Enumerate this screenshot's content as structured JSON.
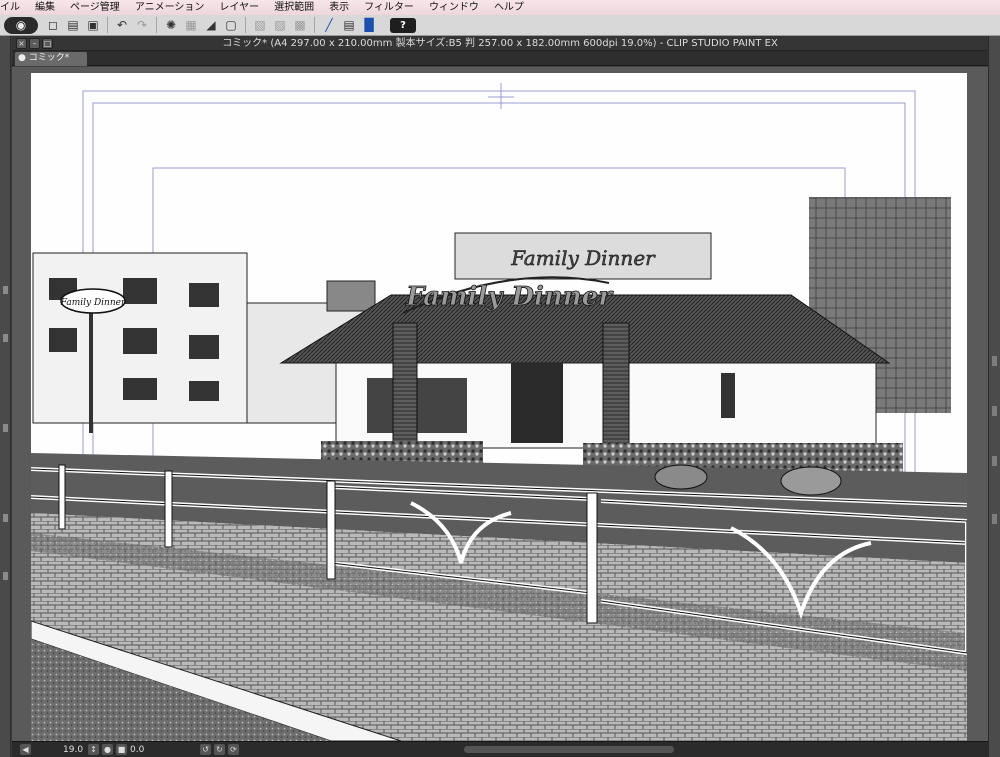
{
  "menubar": {
    "items": [
      "イル",
      "編集",
      "ページ管理",
      "アニメーション",
      "レイヤー",
      "選択範囲",
      "表示",
      "フィルター",
      "ウィンドウ",
      "ヘルプ"
    ]
  },
  "toolbar": {
    "icons": [
      "app-logo-icon",
      "new-file-icon",
      "open-file-icon",
      "save-icon",
      "undo-icon",
      "redo-icon",
      "transform-icon",
      "fill-icon",
      "ruler-icon",
      "help-icon"
    ],
    "help_label": "?"
  },
  "window": {
    "title": "コミック* (A4 297.00 x 210.00mm 製本サイズ:B5 判 257.00 x 182.00mm 600dpi 19.0%)  - CLIP STUDIO PAINT EX",
    "tab_label": "コミック*"
  },
  "artwork": {
    "sign_roof": "Family Dinner",
    "sign_top": "Family Dinner",
    "sign_left": "Family Dinner"
  },
  "statusbar": {
    "zoom": "19.0",
    "angle": "0.0"
  }
}
